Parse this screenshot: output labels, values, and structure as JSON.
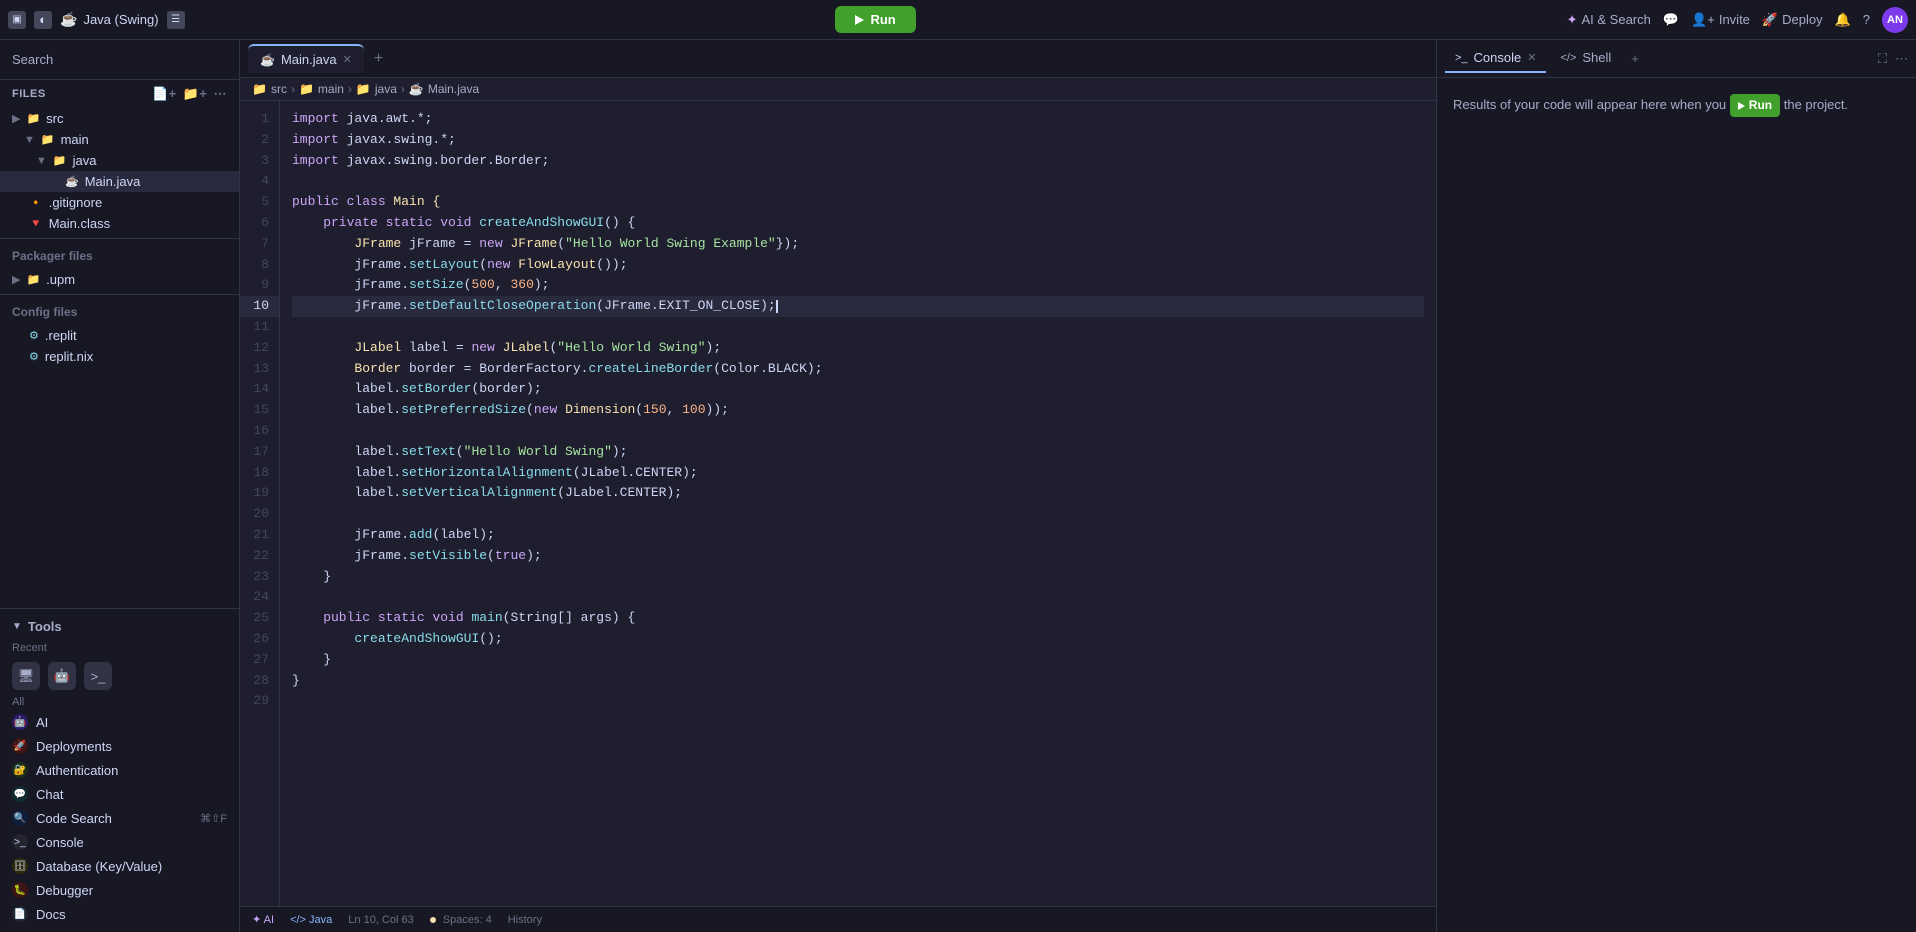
{
  "topbar": {
    "window_icon": "▣",
    "settings_icon": "◐",
    "project_name": "Java (Swing)",
    "layout_icon": "☰",
    "run_label": "Run",
    "ai_search_label": "AI & Search",
    "chat_icon": "💬",
    "invite_icon": "👤",
    "invite_label": "Invite",
    "deploy_icon": "🚀",
    "deploy_label": "Deploy",
    "bell_icon": "🔔",
    "help_icon": "?",
    "avatar": "AN"
  },
  "sidebar": {
    "search_label": "Search",
    "files_label": "Files",
    "tree": [
      {
        "label": "src",
        "type": "folder",
        "indent": 0,
        "icon": "▶"
      },
      {
        "label": "main",
        "type": "folder",
        "indent": 1,
        "icon": "▼"
      },
      {
        "label": "java",
        "type": "folder",
        "indent": 2,
        "icon": "▼"
      },
      {
        "label": "Main.java",
        "type": "java",
        "indent": 3
      },
      {
        "label": ".gitignore",
        "type": "git",
        "indent": 0
      },
      {
        "label": "Main.class",
        "type": "class",
        "indent": 0
      }
    ],
    "packager_files_label": "Packager files",
    "packager_files": [
      {
        "label": ".upm",
        "type": "folder",
        "indent": 0,
        "icon": "▶"
      }
    ],
    "config_files_label": "Config files",
    "config_files": [
      {
        "label": ".replit",
        "type": "config",
        "indent": 0
      },
      {
        "label": "replit.nix",
        "type": "config",
        "indent": 0
      }
    ],
    "tools_label": "Tools",
    "recent_label": "Recent",
    "all_label": "All",
    "tools_list": [
      {
        "label": "AI",
        "icon": "🤖",
        "color": "#cba6f7"
      },
      {
        "label": "Deployments",
        "icon": "🚀",
        "color": "#f38ba8"
      },
      {
        "label": "Authentication",
        "icon": "🔐",
        "color": "#a6e3a1"
      },
      {
        "label": "Chat",
        "icon": "💬",
        "color": "#89dceb"
      },
      {
        "label": "Code Search",
        "icon": "🔍",
        "color": "#89b4fa",
        "shortcut": "⌘⇧F"
      },
      {
        "label": "Console",
        "icon": ">_",
        "color": "#a6adc8"
      },
      {
        "label": "Database (Key/Value)",
        "icon": "🗄",
        "color": "#f9e2af"
      },
      {
        "label": "Debugger",
        "icon": "🐛",
        "color": "#f38ba8"
      },
      {
        "label": "Docs",
        "icon": "📄",
        "color": "#cdd6f4"
      }
    ]
  },
  "editor": {
    "tab_label": "Main.java",
    "breadcrumb": [
      "src",
      "main",
      "java",
      "Main.java"
    ],
    "lines": [
      {
        "num": 1,
        "tokens": [
          {
            "t": "kw",
            "v": "import "
          },
          {
            "t": "plain",
            "v": "java.awt.*;"
          }
        ]
      },
      {
        "num": 2,
        "tokens": [
          {
            "t": "kw",
            "v": "import "
          },
          {
            "t": "plain",
            "v": "javax.swing.*;"
          }
        ]
      },
      {
        "num": 3,
        "tokens": [
          {
            "t": "kw",
            "v": "import "
          },
          {
            "t": "plain",
            "v": "javax.swing.border.Border;"
          }
        ]
      },
      {
        "num": 4,
        "tokens": []
      },
      {
        "num": 5,
        "tokens": [
          {
            "t": "kw",
            "v": "public "
          },
          {
            "t": "kw",
            "v": "class "
          },
          {
            "t": "type",
            "v": "Main "
          },
          {
            "t": "bracket",
            "v": "{"
          }
        ]
      },
      {
        "num": 6,
        "tokens": [
          {
            "t": "kw",
            "v": "    private "
          },
          {
            "t": "kw",
            "v": "static "
          },
          {
            "t": "kw",
            "v": "void "
          },
          {
            "t": "method",
            "v": "createAndShowGUI"
          },
          {
            "t": "plain",
            "v": "() {"
          }
        ]
      },
      {
        "num": 7,
        "tokens": [
          {
            "t": "type",
            "v": "        JFrame "
          },
          {
            "t": "plain",
            "v": "jFrame = "
          },
          {
            "t": "kw",
            "v": "new "
          },
          {
            "t": "type",
            "v": "JFrame"
          },
          {
            "t": "plain",
            "v": "("
          },
          {
            "t": "str",
            "v": "\"Hello World Swing Example\""
          },
          {
            "t": "plain",
            "v": "});"
          }
        ]
      },
      {
        "num": 8,
        "tokens": [
          {
            "t": "plain",
            "v": "        jFrame."
          },
          {
            "t": "method",
            "v": "setLayout"
          },
          {
            "t": "plain",
            "v": "("
          },
          {
            "t": "kw",
            "v": "new "
          },
          {
            "t": "type",
            "v": "FlowLayout"
          },
          {
            "t": "plain",
            "v": "());"
          }
        ]
      },
      {
        "num": 9,
        "tokens": [
          {
            "t": "plain",
            "v": "        jFrame."
          },
          {
            "t": "method",
            "v": "setSize"
          },
          {
            "t": "plain",
            "v": "("
          },
          {
            "t": "num",
            "v": "500"
          },
          {
            "t": "plain",
            "v": ", "
          },
          {
            "t": "num",
            "v": "360"
          },
          {
            "t": "plain",
            "v": ");"
          }
        ]
      },
      {
        "num": 10,
        "tokens": [
          {
            "t": "plain",
            "v": "        jFrame."
          },
          {
            "t": "method",
            "v": "setDefaultCloseOperation"
          },
          {
            "t": "plain",
            "v": "(JFrame.EXIT_ON_CLOSE);"
          }
        ],
        "highlighted": true,
        "cursor": true
      },
      {
        "num": 11,
        "tokens": []
      },
      {
        "num": 12,
        "tokens": [
          {
            "t": "type",
            "v": "        JLabel "
          },
          {
            "t": "plain",
            "v": "label = "
          },
          {
            "t": "kw",
            "v": "new "
          },
          {
            "t": "type",
            "v": "JLabel"
          },
          {
            "t": "plain",
            "v": "("
          },
          {
            "t": "str",
            "v": "\"Hello World Swing\""
          },
          {
            "t": "plain",
            "v": ");"
          }
        ]
      },
      {
        "num": 13,
        "tokens": [
          {
            "t": "type",
            "v": "        Border "
          },
          {
            "t": "plain",
            "v": "border = BorderFactory."
          },
          {
            "t": "method",
            "v": "createLineBorder"
          },
          {
            "t": "plain",
            "v": "(Color.BLACK);"
          }
        ]
      },
      {
        "num": 14,
        "tokens": [
          {
            "t": "plain",
            "v": "        label."
          },
          {
            "t": "method",
            "v": "setBorder"
          },
          {
            "t": "plain",
            "v": "(border);"
          }
        ]
      },
      {
        "num": 15,
        "tokens": [
          {
            "t": "plain",
            "v": "        label."
          },
          {
            "t": "method",
            "v": "setPreferredSize"
          },
          {
            "t": "plain",
            "v": "("
          },
          {
            "t": "kw",
            "v": "new "
          },
          {
            "t": "type",
            "v": "Dimension"
          },
          {
            "t": "plain",
            "v": "("
          },
          {
            "t": "num",
            "v": "150"
          },
          {
            "t": "plain",
            "v": ", "
          },
          {
            "t": "num",
            "v": "100"
          },
          {
            "t": "plain",
            "v": "));"
          }
        ]
      },
      {
        "num": 16,
        "tokens": []
      },
      {
        "num": 17,
        "tokens": [
          {
            "t": "plain",
            "v": "        label."
          },
          {
            "t": "method",
            "v": "setText"
          },
          {
            "t": "plain",
            "v": "("
          },
          {
            "t": "str",
            "v": "\"Hello World Swing\""
          },
          {
            "t": "plain",
            "v": ");"
          }
        ]
      },
      {
        "num": 18,
        "tokens": [
          {
            "t": "plain",
            "v": "        label."
          },
          {
            "t": "method",
            "v": "setHorizontalAlignment"
          },
          {
            "t": "plain",
            "v": "(JLabel.CENTER);"
          }
        ]
      },
      {
        "num": 19,
        "tokens": [
          {
            "t": "plain",
            "v": "        label."
          },
          {
            "t": "method",
            "v": "setVerticalAlignment"
          },
          {
            "t": "plain",
            "v": "(JLabel.CENTER);"
          }
        ]
      },
      {
        "num": 20,
        "tokens": []
      },
      {
        "num": 21,
        "tokens": [
          {
            "t": "plain",
            "v": "        jFrame."
          },
          {
            "t": "method",
            "v": "add"
          },
          {
            "t": "plain",
            "v": "(label);"
          }
        ]
      },
      {
        "num": 22,
        "tokens": [
          {
            "t": "plain",
            "v": "        jFrame."
          },
          {
            "t": "method",
            "v": "setVisible"
          },
          {
            "t": "plain",
            "v": "("
          },
          {
            "t": "kw",
            "v": "true"
          },
          {
            "t": "plain",
            "v": ");"
          }
        ]
      },
      {
        "num": 23,
        "tokens": [
          {
            "t": "plain",
            "v": "    }"
          }
        ]
      },
      {
        "num": 24,
        "tokens": []
      },
      {
        "num": 25,
        "tokens": [
          {
            "t": "kw",
            "v": "    public "
          },
          {
            "t": "kw",
            "v": "static "
          },
          {
            "t": "kw",
            "v": "void "
          },
          {
            "t": "method",
            "v": "main"
          },
          {
            "t": "plain",
            "v": "(String[] args) {"
          }
        ]
      },
      {
        "num": 26,
        "tokens": [
          {
            "t": "plain",
            "v": "        "
          },
          {
            "t": "method",
            "v": "createAndShowGUI"
          },
          {
            "t": "plain",
            "v": "();"
          }
        ]
      },
      {
        "num": 27,
        "tokens": [
          {
            "t": "plain",
            "v": "    }"
          }
        ]
      },
      {
        "num": 28,
        "tokens": [
          {
            "t": "plain",
            "v": "}"
          }
        ]
      },
      {
        "num": 29,
        "tokens": []
      }
    ],
    "status": {
      "ai_label": "AI",
      "lang_label": "Java",
      "position": "Ln 10, Col 63",
      "spaces": "Spaces: 4",
      "history": "History"
    }
  },
  "console": {
    "tab_label": "Console",
    "shell_label": "Shell",
    "message_prefix": "Results of your code will appear here when you",
    "run_inline": "Run",
    "message_suffix": "the project."
  }
}
